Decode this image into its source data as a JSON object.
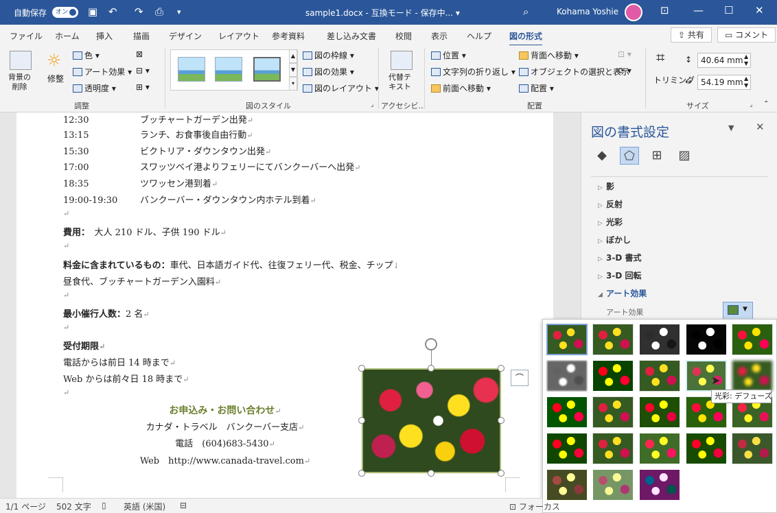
{
  "titlebar": {
    "autosave_label": "自動保存",
    "autosave_state": "オン",
    "doc_title": "sample1.docx - 互換モード - 保存中... ▾",
    "user_name": "Kohama Yoshie"
  },
  "tabs": [
    "ファイル",
    "ホーム",
    "挿入",
    "描画",
    "デザイン",
    "レイアウト",
    "参考資料",
    "差し込み文書",
    "校閲",
    "表示",
    "ヘルプ",
    "図の形式"
  ],
  "share": {
    "share_label": "共有",
    "comment_label": "コメント"
  },
  "ribbon": {
    "remove_bg": "背景の\n削除",
    "corrections": "修整",
    "color": "色",
    "art_effects": "アート効果",
    "transparency": "透明度",
    "group_adjust": "調整",
    "group_styles": "図のスタイル",
    "border": "図の枠線",
    "effects": "図の効果",
    "layout": "図のレイアウト",
    "alt_text": "代替テ\nキスト",
    "group_access": "アクセシビ...",
    "position": "位置",
    "wrap_text": "文字列の折り返し",
    "bring_forward": "前面へ移動",
    "send_backward": "背面へ移動",
    "selection_pane": "オブジェクトの選択と表示",
    "align": "配置",
    "group_arrange": "配置",
    "crop": "トリミング",
    "height": "40.64 mm",
    "width": "54.19 mm",
    "group_size": "サイズ"
  },
  "document": {
    "schedule": [
      {
        "time": "12:30",
        "text": "ブッチャートガーデン出発"
      },
      {
        "time": "13:15",
        "text": "ランチ、お食事後自由行動"
      },
      {
        "time": "15:30",
        "text": "ビクトリア・ダウンタウン出発"
      },
      {
        "time": "17:00",
        "text": "スワッツベイ港よりフェリーにてバンクーバーへ出発"
      },
      {
        "time": "18:35",
        "text": "ツワッセン港到着"
      },
      {
        "time": "19:00-19:30",
        "text": "バンクーバー・ダウンタウン内ホテル到着"
      }
    ],
    "fee_label": "費用：",
    "fee_text": "大人 210 ドル、子供 190 ドル",
    "included_label": "料金に含まれているもの：",
    "included_text": "車代、日本語ガイド代、往復フェリー代、税金、チップ",
    "included_text2": "昼食代、ブッチャートガーデン入園料",
    "min_label": "最小催行人数：",
    "min_text": "2 名",
    "deadline_label": "受付期限",
    "deadline_phone": "電話からは前日 14 時まで",
    "deadline_web": "Web からは前々日 18 時まで",
    "contact_title": "お申込み・お問い合わせ",
    "contact_company": "カナダ・トラベル　バンクーバー支店",
    "contact_phone": "電話　(604)683-5430",
    "contact_web": "Web　http://www.canada-travel.com"
  },
  "pane": {
    "title": "図の書式設定",
    "sections": [
      "影",
      "反射",
      "光彩",
      "ぼかし",
      "3-D 書式",
      "3-D 回転",
      "アート効果"
    ],
    "art_label": "アート効果"
  },
  "tooltip": "光彩: デフューズ",
  "status": {
    "page": "1/1 ページ",
    "words": "502 文字",
    "lang": "英語 (米国)",
    "focus": "フォーカス"
  }
}
